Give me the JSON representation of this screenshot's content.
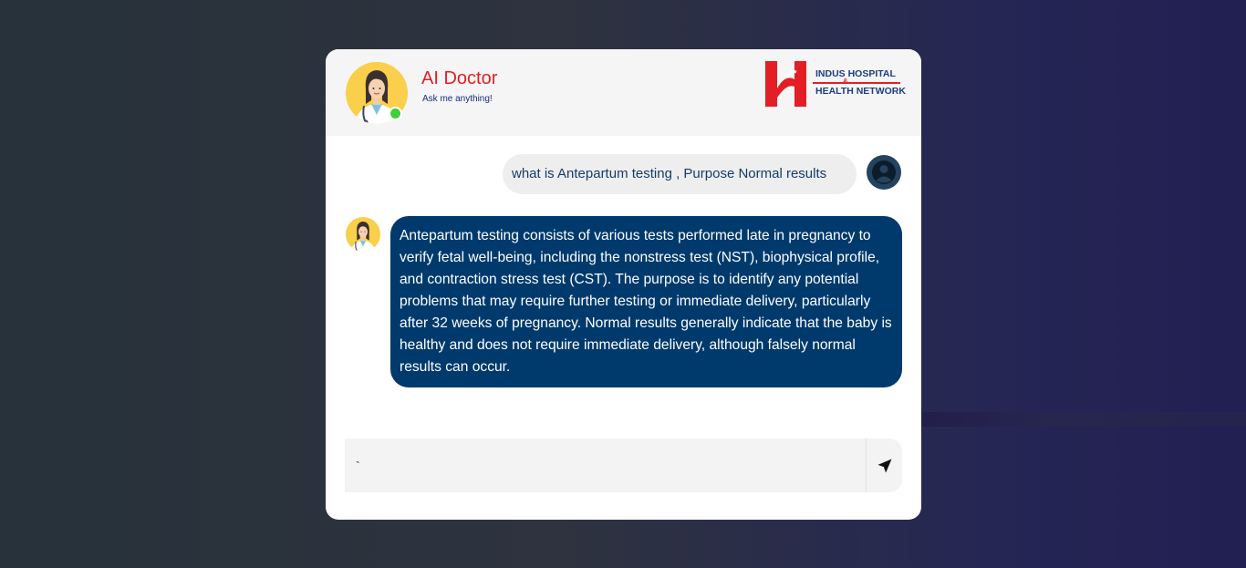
{
  "header": {
    "title": "AI Doctor",
    "subtitle": "Ask me anything!",
    "logo": {
      "line1": "INDUS HOSPITAL",
      "amp": "&",
      "line2": "HEALTH NETWORK"
    },
    "online_status_color": "#3ecf3c"
  },
  "messages": [
    {
      "sender": "user",
      "text": "what is Antepartum testing , Purpose Normal results",
      "avatar_icon": "user-avatar-icon"
    },
    {
      "sender": "bot",
      "text": "Antepartum testing consists of various tests performed late in pregnancy to verify fetal well-being, including the nonstress test (NST), biophysical profile, and contraction stress test (CST). The purpose is to identify any potential problems that may require further testing or immediate delivery, particularly after 32 weeks of pregnancy. Normal results generally indicate that the baby is healthy and does not require immediate delivery, although falsely normal results can occur.",
      "avatar_icon": "doctor-avatar-icon"
    }
  ],
  "input": {
    "value": "`",
    "send_icon": "send-icon"
  },
  "colors": {
    "title": "#e31e24",
    "bot_bubble": "#003a6d",
    "user_bubble": "#eeeeee",
    "user_text": "#143c6b"
  }
}
